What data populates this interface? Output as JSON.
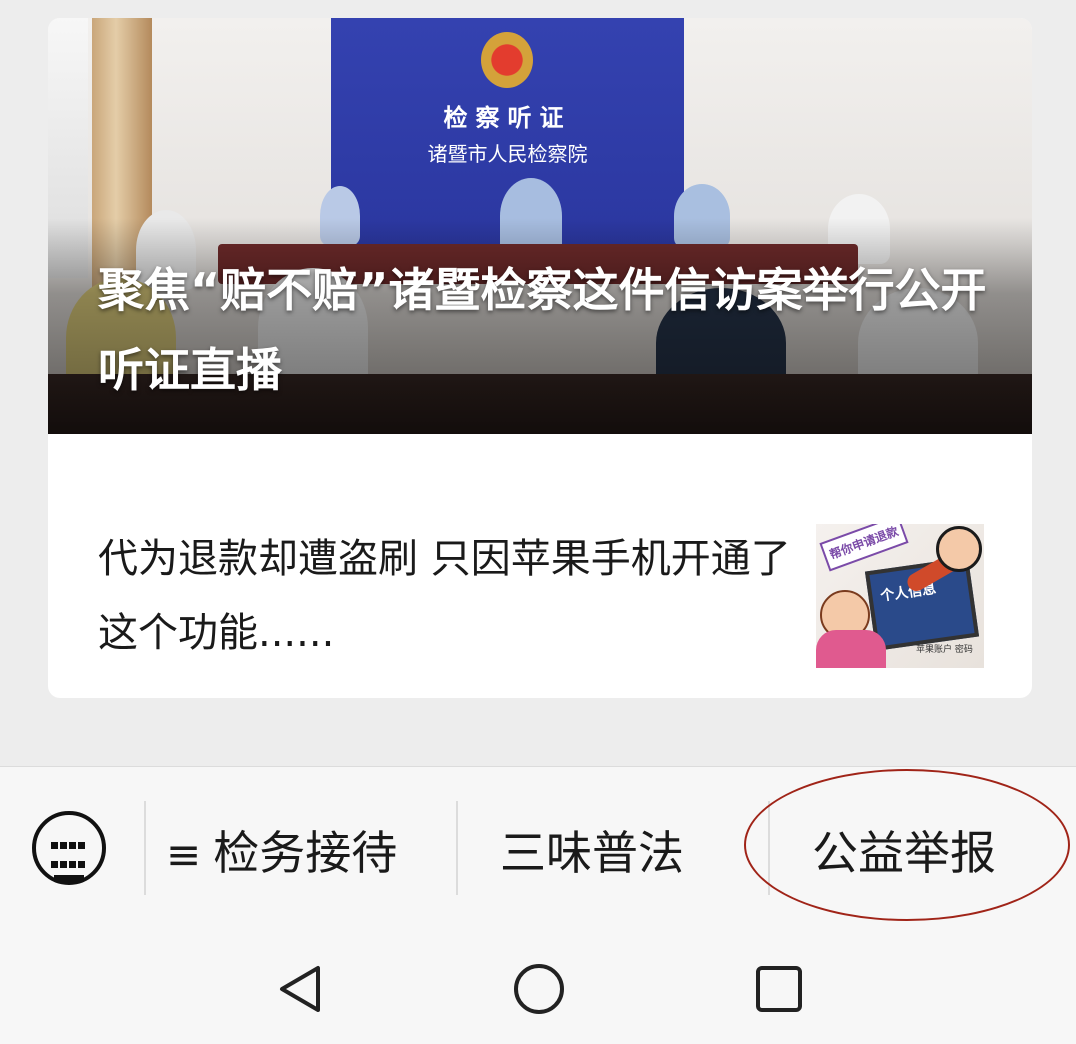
{
  "feed": {
    "hero_article": {
      "title": "聚焦“赔不赔”诸暨检察这件信访案举行公开听证直播",
      "image": {
        "backdrop_title": "检察听证",
        "backdrop_subtitle": "诸暨市人民检察院"
      }
    },
    "article": {
      "title": "代为退款却遭盗刷 只因苹果手机开通了这个功能......",
      "thumbnail": {
        "sign_text": "帮你申请退款",
        "screen_text": "个人信息",
        "note_text": "苹果账户 密码"
      }
    }
  },
  "menu": {
    "keyboard_icon": "keyboard-icon",
    "items": [
      {
        "label": "检务接待",
        "has_submenu_icon": true
      },
      {
        "label": "三味普法"
      },
      {
        "label": "公益举报",
        "highlighted": true
      }
    ],
    "highlight_color": "#a02418"
  },
  "system_nav": {
    "buttons": [
      "back-triangle-icon",
      "home-circle-icon",
      "recent-square-icon"
    ]
  }
}
